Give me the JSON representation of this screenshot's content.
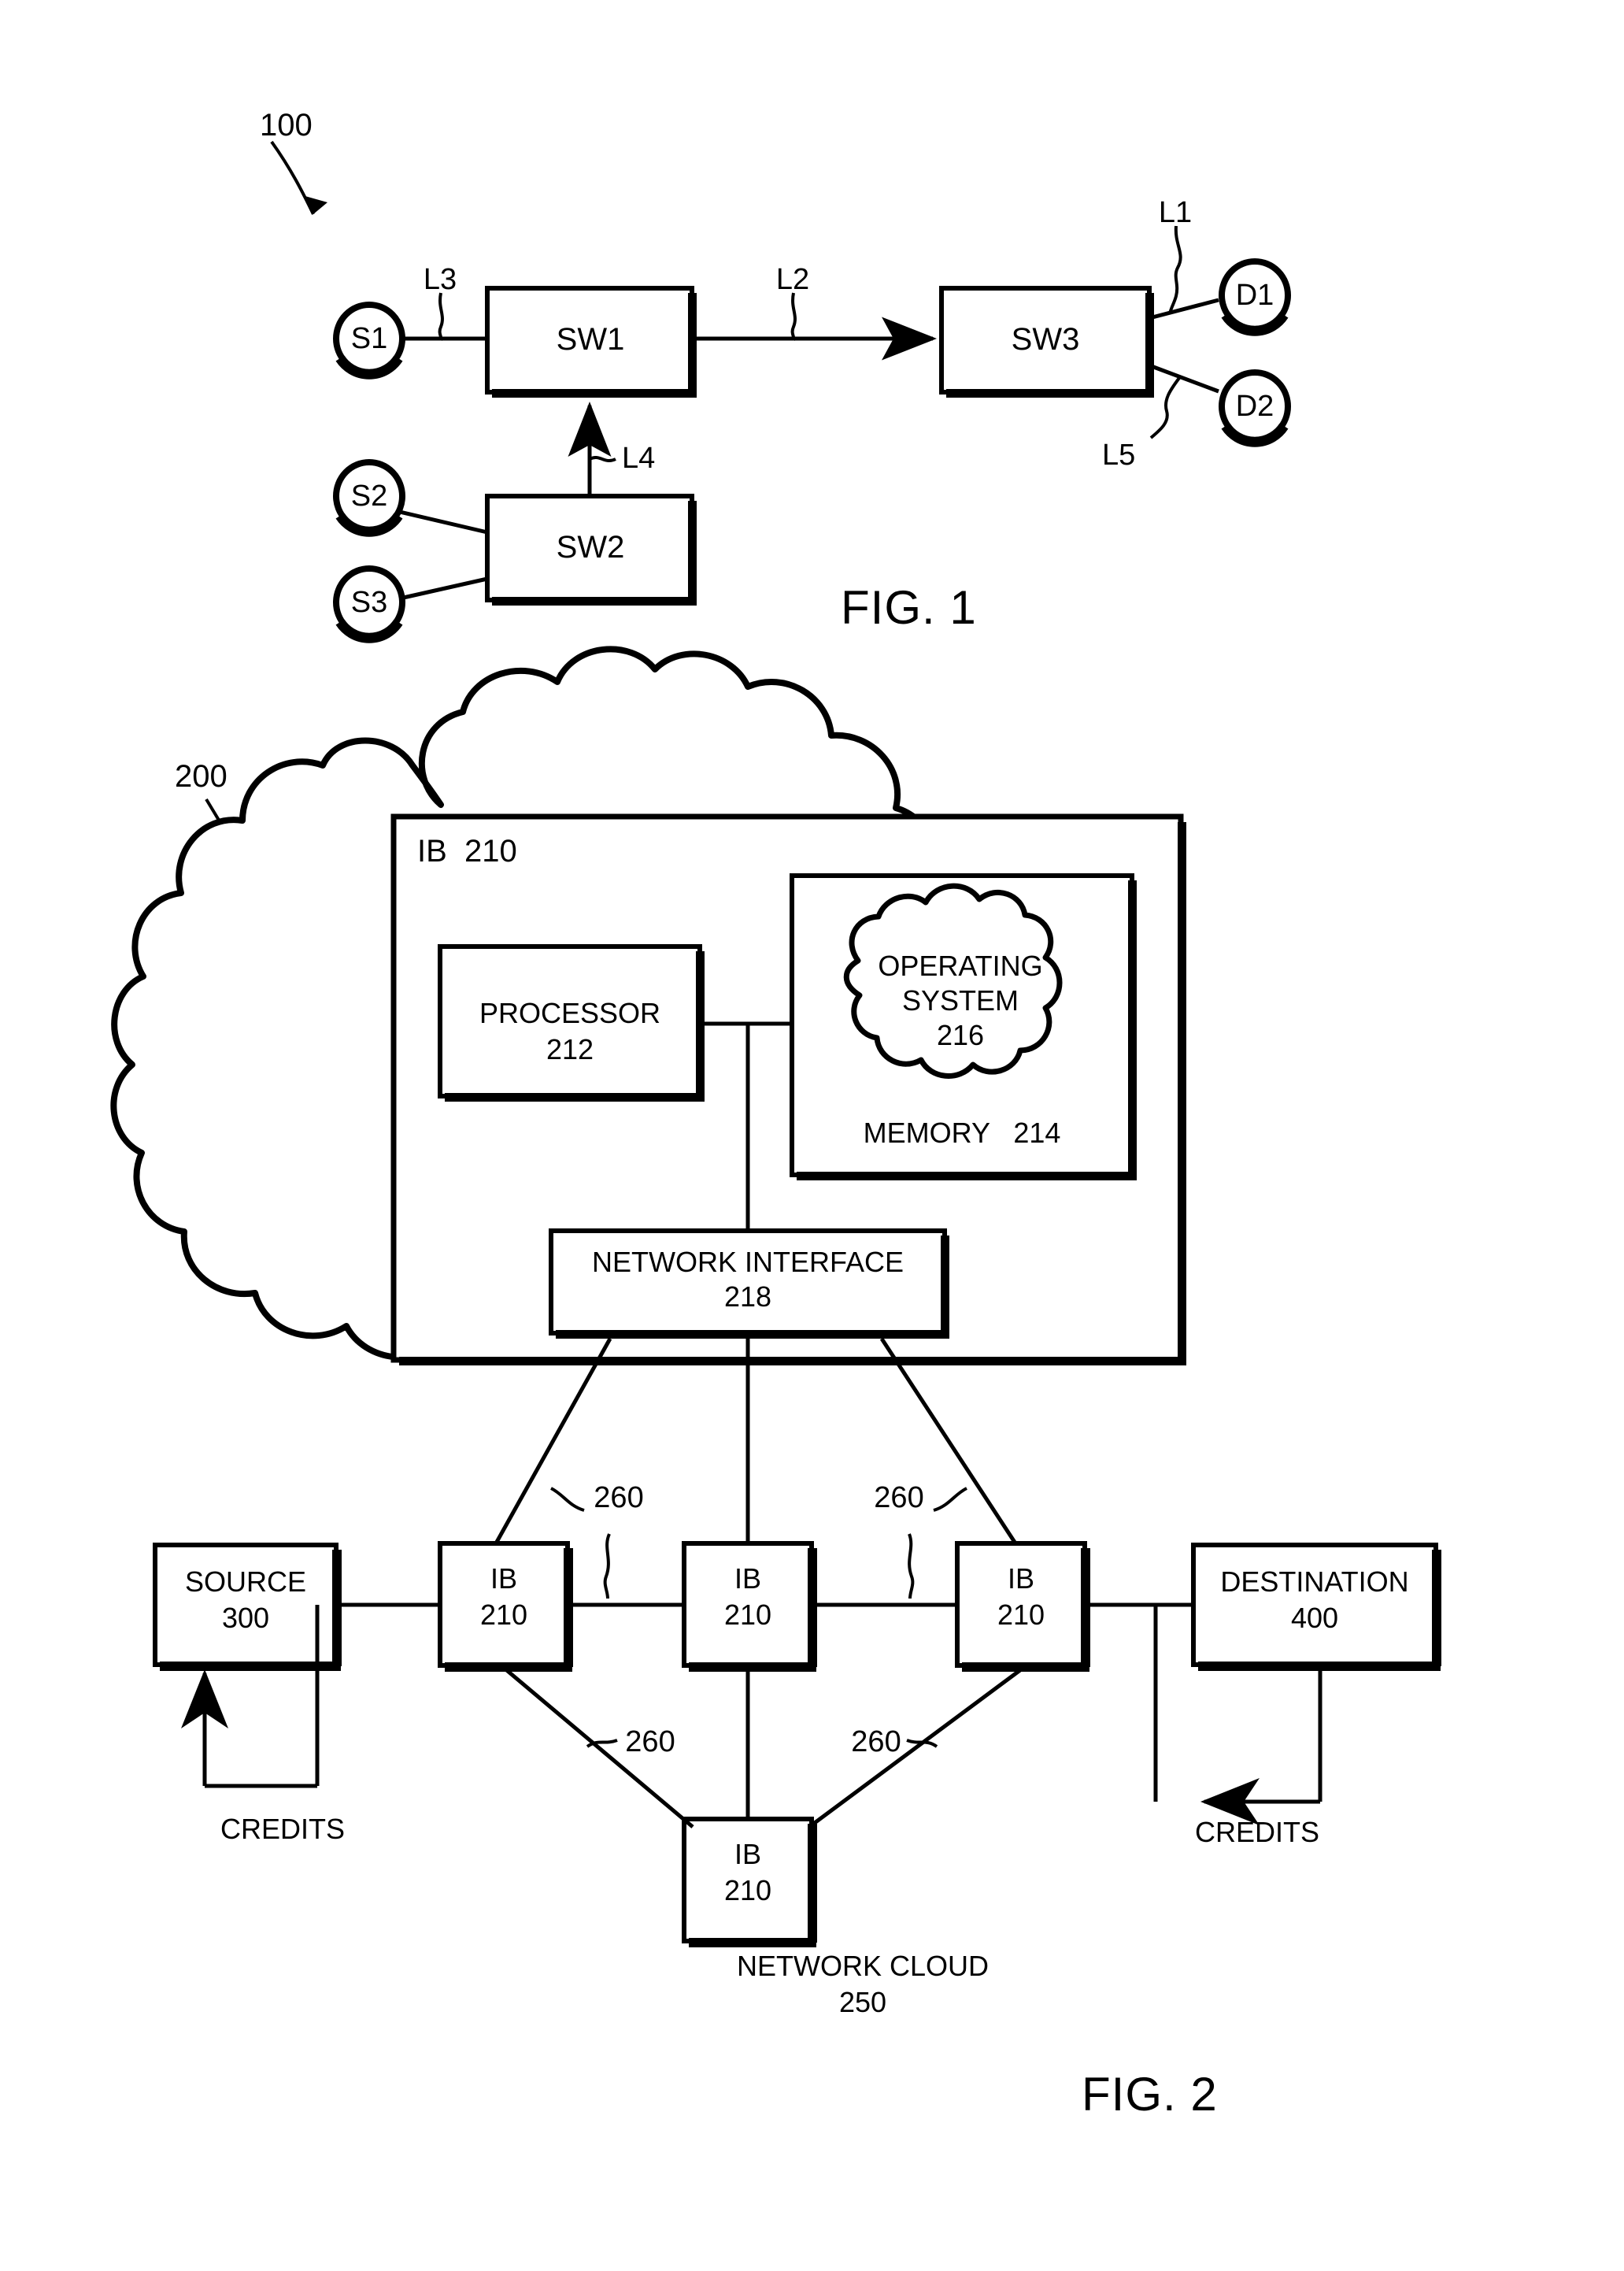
{
  "document": {
    "type": "patent-drawing-sheet",
    "background_color": "#ffffff",
    "ink_color": "#000000"
  },
  "figures": [
    {
      "id": "fig1",
      "caption": "FIG. 1",
      "reference_numeral": "100",
      "nodes": [
        {
          "name": "source-node-s1",
          "label": "S1",
          "shape": "circle"
        },
        {
          "name": "source-node-s2",
          "label": "S2",
          "shape": "circle"
        },
        {
          "name": "source-node-s3",
          "label": "S3",
          "shape": "circle"
        },
        {
          "name": "destination-node-d1",
          "label": "D1",
          "shape": "circle"
        },
        {
          "name": "destination-node-d2",
          "label": "D2",
          "shape": "circle"
        }
      ],
      "switches": [
        {
          "name": "switch-sw1",
          "label": "SW1",
          "shape": "rect"
        },
        {
          "name": "switch-sw2",
          "label": "SW2",
          "shape": "rect"
        },
        {
          "name": "switch-sw3",
          "label": "SW3",
          "shape": "rect"
        }
      ],
      "links": [
        {
          "name": "link-l1",
          "label": "L1",
          "from": "SW3",
          "to": "D1"
        },
        {
          "name": "link-l2",
          "label": "L2",
          "from": "SW1",
          "to": "SW3"
        },
        {
          "name": "link-l3",
          "label": "L3",
          "from": "S1",
          "to": "SW1"
        },
        {
          "name": "link-l4",
          "label": "L4",
          "from": "SW2",
          "to": "SW1"
        },
        {
          "name": "link-l5",
          "label": "L5",
          "from": "SW3",
          "to": "D2"
        }
      ]
    },
    {
      "id": "fig2",
      "caption": "FIG. 2",
      "reference_numeral": "200",
      "cloud": {
        "name": "network-cloud",
        "label_line1": "NETWORK CLOUD",
        "label_line2": "250"
      },
      "detail_box": {
        "name": "ib-detail-box",
        "label": "IB  210",
        "children": [
          {
            "name": "processor-box",
            "label_line1": "PROCESSOR",
            "label_line2": "212"
          },
          {
            "name": "memory-box",
            "label": "MEMORY   214"
          },
          {
            "name": "operating-system-cloud",
            "label_line1": "OPERATING",
            "label_line2": "SYSTEM",
            "label_line3": "216"
          },
          {
            "name": "network-interface-box",
            "label_line1": "NETWORK INTERFACE",
            "label_line2": "218"
          }
        ]
      },
      "endpoints": [
        {
          "name": "source-box",
          "label_line1": "SOURCE",
          "label_line2": "300"
        },
        {
          "name": "destination-box",
          "label_line1": "DESTINATION",
          "label_line2": "400"
        }
      ],
      "ib_nodes": [
        {
          "name": "ib-node-left",
          "label_line1": "IB",
          "label_line2": "210"
        },
        {
          "name": "ib-node-center",
          "label_line1": "IB",
          "label_line2": "210"
        },
        {
          "name": "ib-node-right",
          "label_line1": "IB",
          "label_line2": "210"
        },
        {
          "name": "ib-node-bottom",
          "label_line1": "IB",
          "label_line2": "210"
        }
      ],
      "link_refs": [
        {
          "name": "link-ref-260-upper-left",
          "label": "260"
        },
        {
          "name": "link-ref-260-upper-right",
          "label": "260"
        },
        {
          "name": "link-ref-260-lower-left",
          "label": "260"
        },
        {
          "name": "link-ref-260-lower-right",
          "label": "260"
        }
      ],
      "credit_flows": [
        {
          "name": "credits-label-left",
          "label": "CREDITS"
        },
        {
          "name": "credits-label-right",
          "label": "CREDITS"
        }
      ]
    }
  ]
}
